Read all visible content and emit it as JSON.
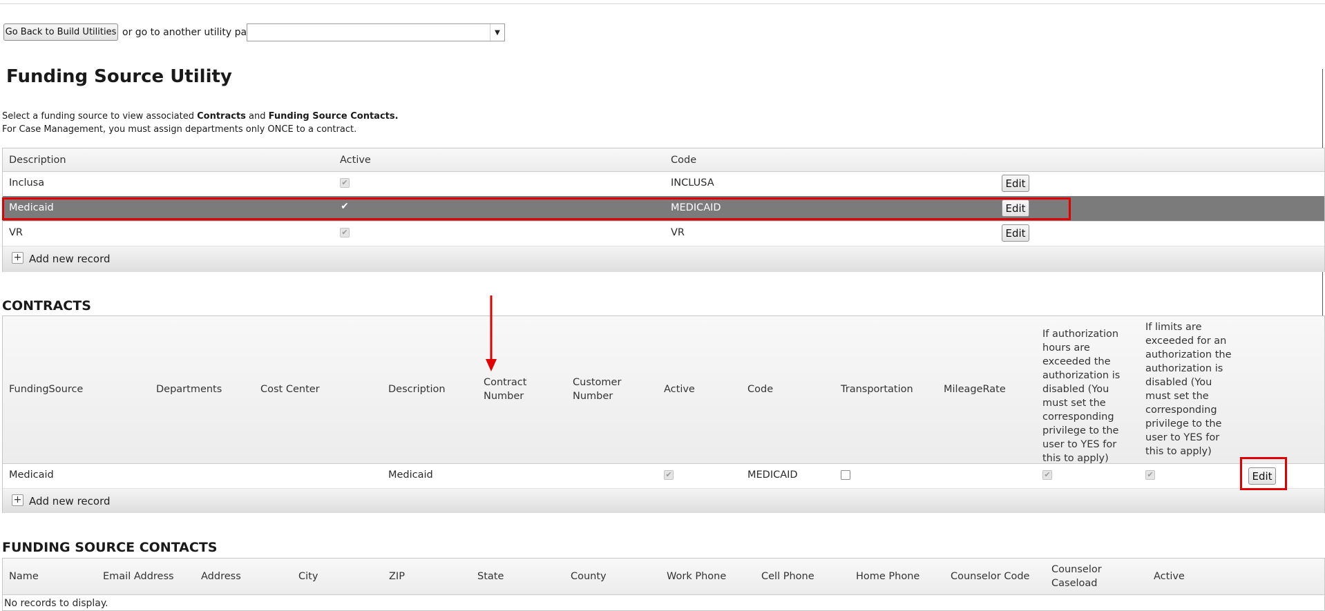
{
  "toolbar": {
    "back_label": "Go Back to Build Utilities",
    "goto_label": "or go to another utility page:",
    "utility_select_value": ""
  },
  "page": {
    "title": "Funding Source Utility",
    "intro_prefix": "Select a funding source to view associated ",
    "intro_contracts": "Contracts",
    "intro_and": " and ",
    "intro_contacts": "Funding Source Contacts.",
    "intro_line2": "For Case Management, you must assign departments only ONCE to a contract."
  },
  "funding_grid": {
    "headers": {
      "description": "Description",
      "active": "Active",
      "code": "Code"
    },
    "rows": [
      {
        "description": "Inclusa",
        "active": true,
        "code": "INCLUSA",
        "edit": "Edit",
        "selected": false
      },
      {
        "description": "Medicaid",
        "active": true,
        "code": "MEDICAID",
        "edit": "Edit",
        "selected": true
      },
      {
        "description": "VR",
        "active": true,
        "code": "VR",
        "edit": "Edit",
        "selected": false
      }
    ],
    "add_label": "Add new record"
  },
  "contracts": {
    "title": "CONTRACTS",
    "headers": {
      "funding_source": "FundingSource",
      "departments": "Departments",
      "cost_center": "Cost Center",
      "description": "Description",
      "contract_number": "Contract Number",
      "customer_number": "Customer Number",
      "active": "Active",
      "code": "Code",
      "transportation": "Transportation",
      "mileage_rate": "MileageRate",
      "auth_hours": "If authorization hours are exceeded the authorization is disabled (You must set the corresponding privilege to the user to YES for this to apply)",
      "limits": "If limits are exceeded for an authorization the authorization is disabled (You must set the corresponding privilege to the user to YES for this to apply)"
    },
    "rows": [
      {
        "funding_source": "Medicaid",
        "departments": "",
        "cost_center": "",
        "description": "Medicaid",
        "contract_number": "",
        "customer_number": "",
        "active": true,
        "code": "MEDICAID",
        "transportation": false,
        "mileage_rate": "",
        "auth_hours": true,
        "limits": true,
        "edit": "Edit"
      }
    ],
    "add_label": "Add new record"
  },
  "contacts": {
    "title": "FUNDING SOURCE CONTACTS",
    "headers": {
      "name": "Name",
      "email": "Email Address",
      "address": "Address",
      "city": "City",
      "zip": "ZIP",
      "state": "State",
      "county": "County",
      "work_phone": "Work Phone",
      "cell_phone": "Cell Phone",
      "home_phone": "Home Phone",
      "counselor_code": "Counselor Code",
      "counselor_caseload": "Counselor Caseload",
      "active": "Active"
    },
    "empty_text": "No records to display."
  },
  "colors": {
    "selected_row": "#7b7b7b",
    "annotation": "#e00000"
  }
}
